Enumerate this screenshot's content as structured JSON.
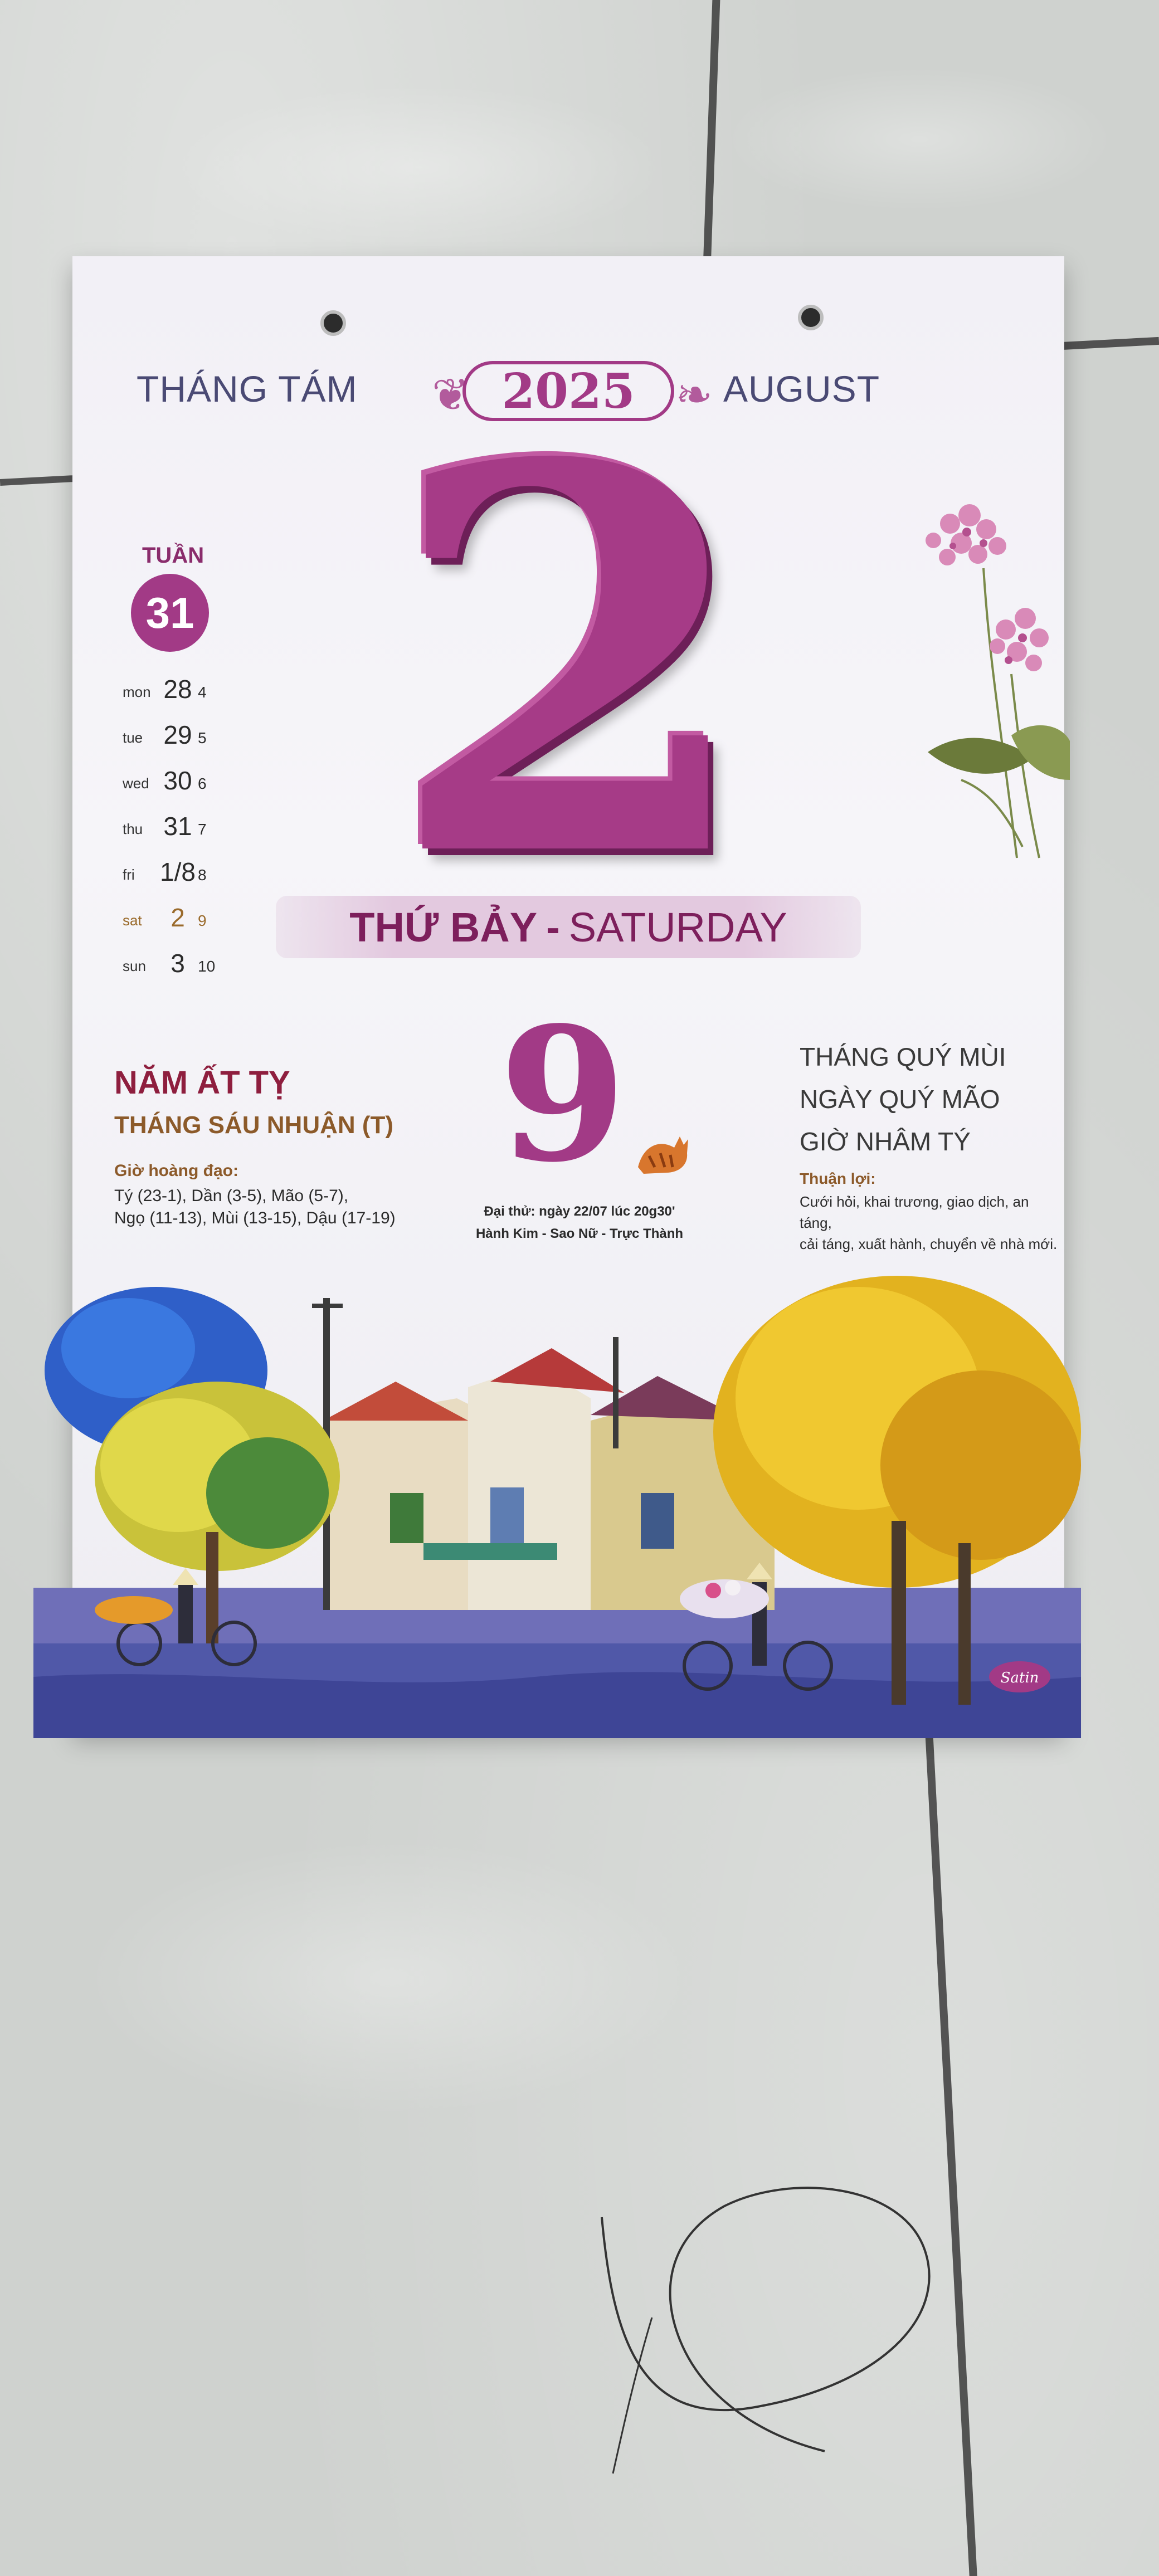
{
  "calendar": {
    "month_vn": "THÁNG TÁM",
    "month_en": "AUGUST",
    "year": "2025",
    "day": "2",
    "week": {
      "label": "TUẦN",
      "number": "31"
    },
    "week_days": [
      {
        "name": "mon",
        "date": "28",
        "lunar": "4"
      },
      {
        "name": "tue",
        "date": "29",
        "lunar": "5"
      },
      {
        "name": "wed",
        "date": "30",
        "lunar": "6"
      },
      {
        "name": "thu",
        "date": "31",
        "lunar": "7"
      },
      {
        "name": "fri",
        "date": "1/8",
        "lunar": "8"
      },
      {
        "name": "sat",
        "date": "2",
        "lunar": "9"
      },
      {
        "name": "sun",
        "date": "3",
        "lunar": "10"
      }
    ],
    "weekday_vn": "THỨ BẢY",
    "weekday_sep": "-",
    "weekday_en": "SATURDAY",
    "lunar_year": "NĂM ẤT TỴ",
    "lunar_month": "THÁNG SÁU NHUẬN (T)",
    "good_hours_title": "Giờ hoàng đạo:",
    "good_hours_line1": "Tý (23-1), Dần (3-5), Mão (5-7),",
    "good_hours_line2": "Ngọ (11-13), Mùi (13-15), Dậu (17-19)",
    "lunar_day": "9",
    "center_line1": "Đại thử: ngày 22/07 lúc 20g30'",
    "center_line2": "Hành Kim - Sao Nữ - Trực Thành",
    "can_chi_month": "THÁNG QUÝ MÙI",
    "can_chi_day": "NGÀY QUÝ MÃO",
    "can_chi_hour": "GIỜ NHÂM TÝ",
    "favorable_title": "Thuận lợi:",
    "favorable_line1": "Cưới hỏi, khai trương, giao dịch, an táng,",
    "favorable_line2": "cải táng, xuất hành, chuyển về nhà mới.",
    "painting_signature": "Satin"
  },
  "colors": {
    "accent": "#a23a86",
    "dark_accent": "#7d1f5c",
    "brown": "#8c5a2a",
    "header": "#4a4a74",
    "floor": "#cfd2cf"
  }
}
